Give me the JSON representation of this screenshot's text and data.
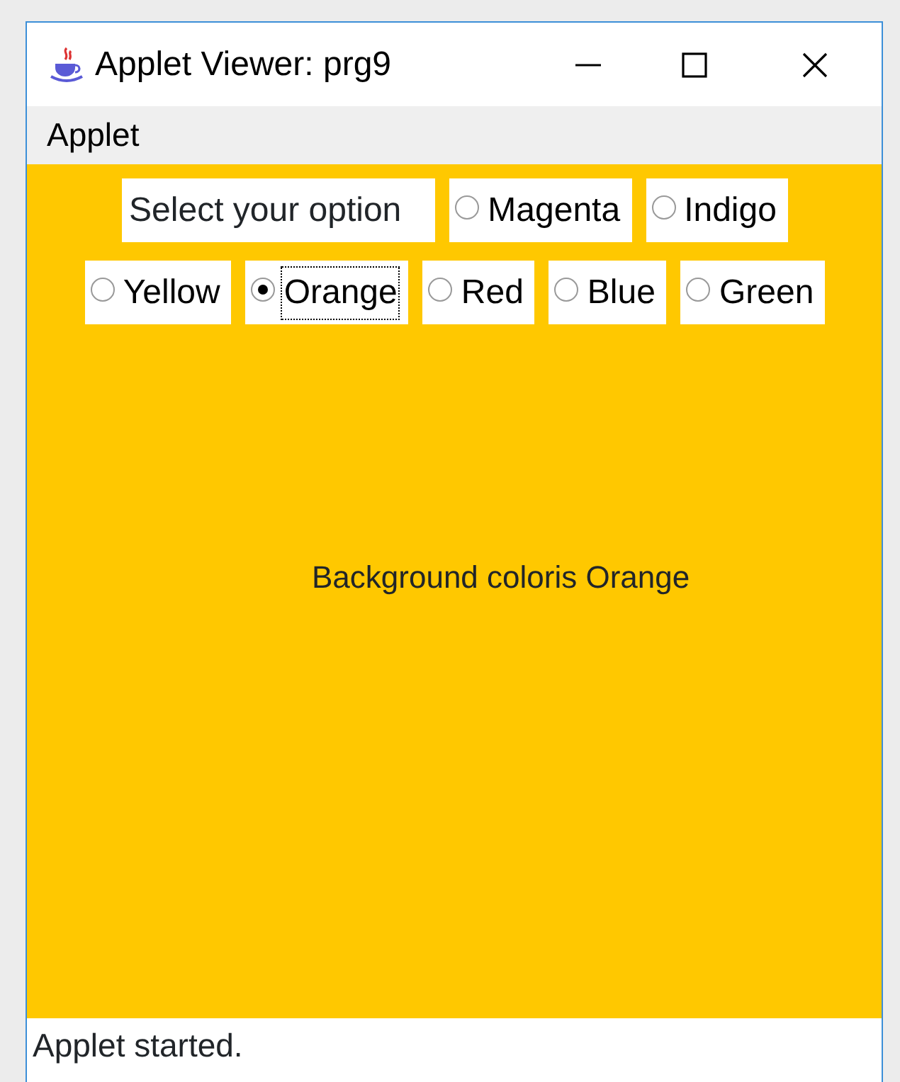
{
  "window": {
    "title": "Applet Viewer: prg9"
  },
  "menu": [
    "Applet"
  ],
  "applet": {
    "prompt": "Select your option",
    "options": [
      {
        "label": "Magenta",
        "selected": false,
        "focused": false
      },
      {
        "label": "Indigo",
        "selected": false,
        "focused": false
      },
      {
        "label": "Yellow",
        "selected": false,
        "focused": false
      },
      {
        "label": "Orange",
        "selected": true,
        "focused": true
      },
      {
        "label": "Red",
        "selected": false,
        "focused": false
      },
      {
        "label": "Blue",
        "selected": false,
        "focused": false
      },
      {
        "label": "Green",
        "selected": false,
        "focused": false
      }
    ],
    "message": "Background coloris Orange"
  },
  "status_bar": "Applet started."
}
